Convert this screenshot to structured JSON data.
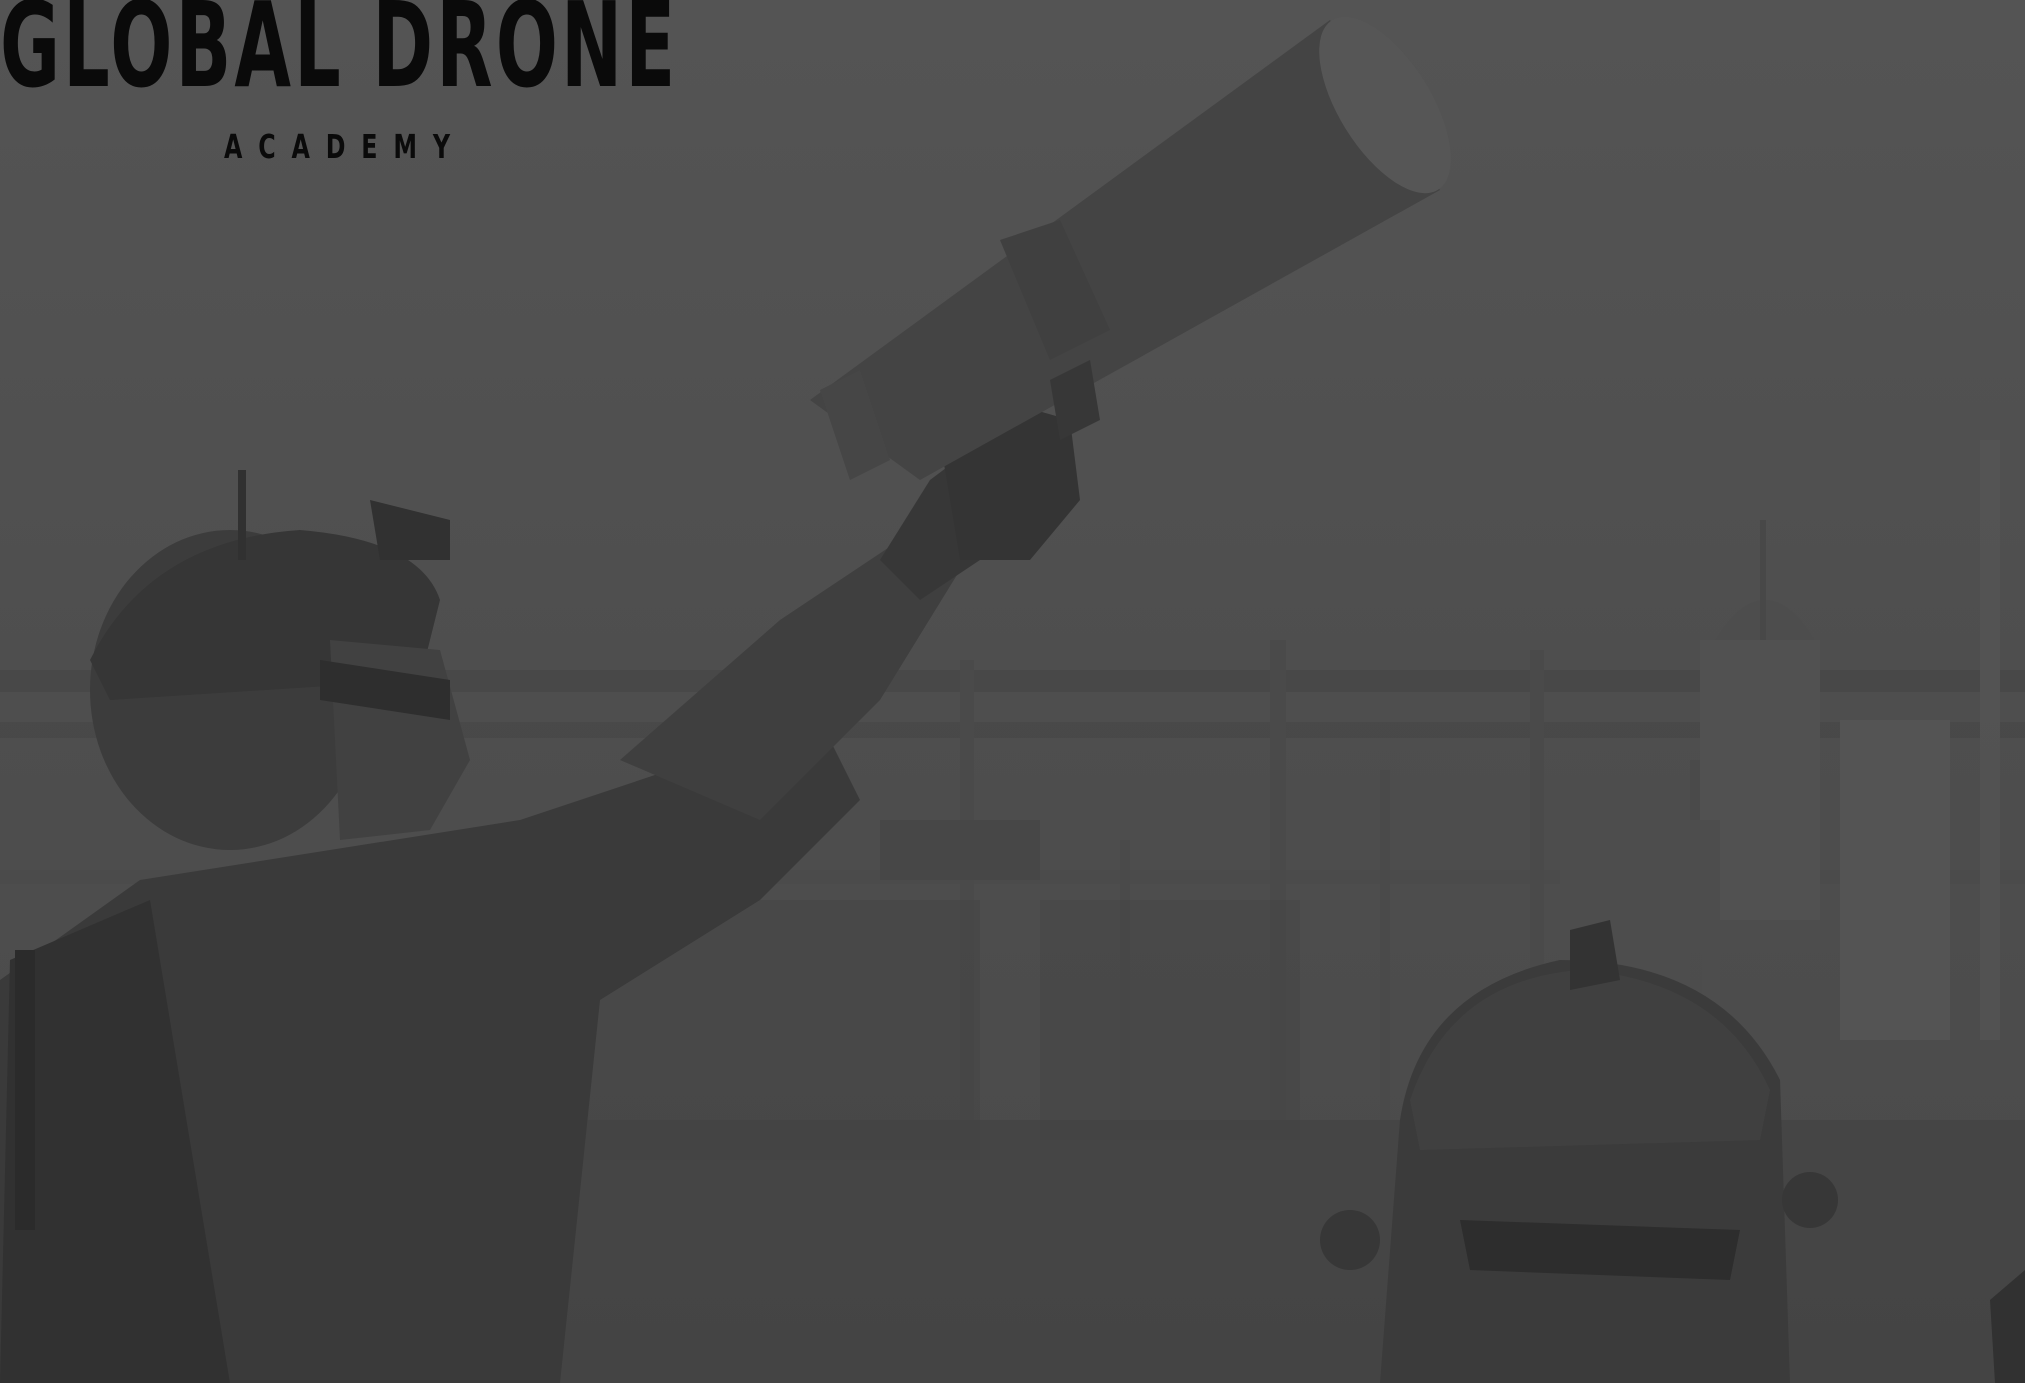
{
  "logo": {
    "title": "GLOBAL DRONE",
    "subtitle": "ACADEMY"
  },
  "photo": {
    "subject": "soldier-aiming-counter-drone-device",
    "tone": "grayscale-darkened"
  }
}
